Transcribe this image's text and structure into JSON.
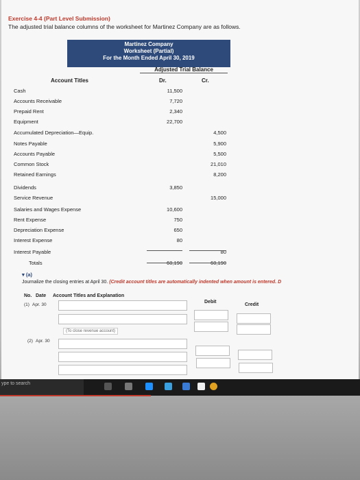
{
  "exercise": {
    "title": "Exercise 4-4 (Part Level Submission)",
    "description": "The adjusted trial balance columns of the worksheet for Martinez Company are as follows."
  },
  "worksheet": {
    "company": "Martinez Company",
    "subtitle": "Worksheet (Partial)",
    "period": "For the Month Ended April 30, 2019",
    "atb_header": "Adjusted Trial Balance",
    "col_account": "Account Titles",
    "col_dr": "Dr.",
    "col_cr": "Cr.",
    "rows": [
      {
        "title": "Cash",
        "dr": "11,500",
        "cr": ""
      },
      {
        "title": "Accounts Receivable",
        "dr": "7,720",
        "cr": ""
      },
      {
        "title": "Prepaid Rent",
        "dr": "2,340",
        "cr": ""
      },
      {
        "title": "Equipment",
        "dr": "22,700",
        "cr": ""
      },
      {
        "title": "Accumulated Depreciation—Equip.",
        "dr": "",
        "cr": "4,500"
      },
      {
        "title": "Notes Payable",
        "dr": "",
        "cr": "5,900"
      },
      {
        "title": "Accounts Payable",
        "dr": "",
        "cr": "5,500"
      },
      {
        "title": "Common Stock",
        "dr": "",
        "cr": "21,010"
      },
      {
        "title": "Retained Earnings",
        "dr": "",
        "cr": "8,200"
      },
      {
        "title": "Dividends",
        "dr": "3,850",
        "cr": ""
      },
      {
        "title": "Service Revenue",
        "dr": "",
        "cr": "15,000"
      },
      {
        "title": "Salaries and Wages Expense",
        "dr": "10,600",
        "cr": ""
      },
      {
        "title": "Rent Expense",
        "dr": "750",
        "cr": ""
      },
      {
        "title": "Depreciation Expense",
        "dr": "650",
        "cr": ""
      },
      {
        "title": "Interest Expense",
        "dr": "80",
        "cr": ""
      },
      {
        "title": "Interest Payable",
        "dr": "",
        "cr": "80"
      },
      {
        "title": "Totals",
        "dr": "60,190",
        "cr": "60,190"
      }
    ]
  },
  "part_a": {
    "label": "(a)",
    "instruction": "Journalize the closing entries at April 30.",
    "instruction_red": "(Credit account titles are automatically indented when amount is entered. D",
    "col_no": "No.",
    "col_date": "Date",
    "col_titles": "Account Titles and Explanation",
    "col_debit": "Debit",
    "col_credit": "Credit",
    "entry1_no": "(1)",
    "entry1_date": "Apr. 30",
    "entry1_note": "(To close revenue account)",
    "entry2_no": "(2)",
    "entry2_date": "Apr. 30"
  },
  "taskbar": {
    "search": "ype to search"
  }
}
